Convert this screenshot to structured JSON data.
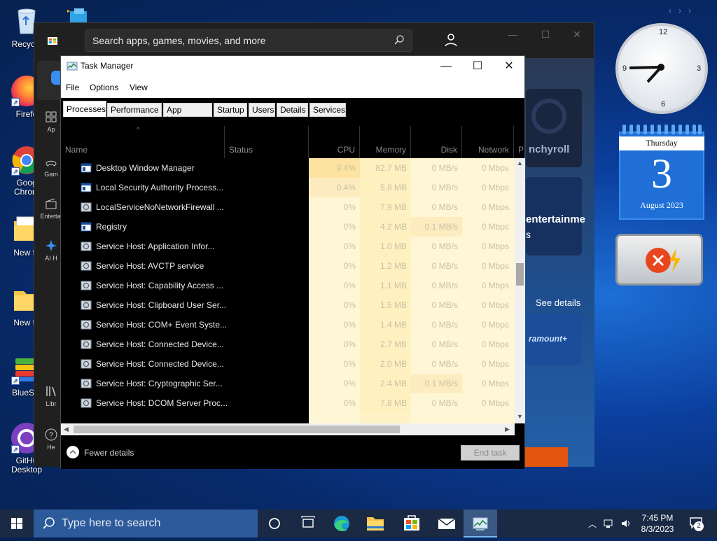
{
  "desktop": {
    "icons": [
      {
        "label": "Recycle",
        "name": "recycle-bin"
      },
      {
        "label": "Firefo",
        "name": "firefox"
      },
      {
        "label": "Goog\nChrom",
        "name": "google-chrome"
      },
      {
        "label": "New fo",
        "name": "new-folder-1"
      },
      {
        "label": "New fo",
        "name": "new-folder-2"
      },
      {
        "label": "BlueSta",
        "name": "bluestacks"
      },
      {
        "label": "GitHu\nDesktop",
        "name": "github-desktop"
      }
    ]
  },
  "store": {
    "search_placeholder": "Search apps, games, movies, and more",
    "nav": [
      {
        "label": "Ap"
      },
      {
        "label": "Gam"
      },
      {
        "label": "Entertai"
      },
      {
        "label": "AI H"
      },
      {
        "label": "Libr"
      },
      {
        "label": "He"
      }
    ],
    "tiles": {
      "crunchyroll": "nchyroll",
      "entertainment": "entertainme",
      "entertainment_sub": "s",
      "see_details": "See details",
      "paramount": "ramount+"
    }
  },
  "task_manager": {
    "title": "Task Manager",
    "menu": [
      "File",
      "Options",
      "View"
    ],
    "tabs": [
      "Processes",
      "Performance",
      "App history",
      "Startup",
      "Users",
      "Details",
      "Services"
    ],
    "active_tab": "Processes",
    "columns": {
      "name": "Name",
      "status": "Status",
      "cpu": "CPU",
      "memory": "Memory",
      "disk": "Disk",
      "network": "Network",
      "power": "P"
    },
    "rows": [
      {
        "name": "Desktop Window Manager",
        "cpu": "9.4%",
        "memory": "82.7 MB",
        "disk": "0 MB/s",
        "network": "0 Mbps",
        "icon": "window-icon"
      },
      {
        "name": "Local Security Authority Process...",
        "cpu": "0.4%",
        "memory": "5.8 MB",
        "disk": "0 MB/s",
        "network": "0 Mbps",
        "icon": "window-icon"
      },
      {
        "name": "LocalServiceNoNetworkFirewall ...",
        "cpu": "0%",
        "memory": "7.9 MB",
        "disk": "0 MB/s",
        "network": "0 Mbps",
        "icon": "gear-icon"
      },
      {
        "name": "Registry",
        "cpu": "0%",
        "memory": "4.2 MB",
        "disk": "0.1 MB/s",
        "network": "0 Mbps",
        "icon": "window-icon"
      },
      {
        "name": "Service Host: Application Infor...",
        "cpu": "0%",
        "memory": "1.0 MB",
        "disk": "0 MB/s",
        "network": "0 Mbps",
        "icon": "gear-icon"
      },
      {
        "name": "Service Host: AVCTP service",
        "cpu": "0%",
        "memory": "1.2 MB",
        "disk": "0 MB/s",
        "network": "0 Mbps",
        "icon": "gear-icon"
      },
      {
        "name": "Service Host: Capability Access ...",
        "cpu": "0%",
        "memory": "1.1 MB",
        "disk": "0 MB/s",
        "network": "0 Mbps",
        "icon": "gear-icon"
      },
      {
        "name": "Service Host: Clipboard User Ser...",
        "cpu": "0%",
        "memory": "1.5 MB",
        "disk": "0 MB/s",
        "network": "0 Mbps",
        "icon": "gear-icon"
      },
      {
        "name": "Service Host: COM+ Event Syste...",
        "cpu": "0%",
        "memory": "1.4 MB",
        "disk": "0 MB/s",
        "network": "0 Mbps",
        "icon": "gear-icon"
      },
      {
        "name": "Service Host: Connected Device...",
        "cpu": "0%",
        "memory": "2.7 MB",
        "disk": "0 MB/s",
        "network": "0 Mbps",
        "icon": "gear-icon"
      },
      {
        "name": "Service Host: Connected Device...",
        "cpu": "0%",
        "memory": "2.0 MB",
        "disk": "0 MB/s",
        "network": "0 Mbps",
        "icon": "gear-icon"
      },
      {
        "name": "Service Host: Cryptographic Ser...",
        "cpu": "0%",
        "memory": "2.4 MB",
        "disk": "0.1 MB/s",
        "network": "0 Mbps",
        "icon": "gear-icon"
      },
      {
        "name": "Service Host: DCOM Server Proc...",
        "cpu": "0%",
        "memory": "7.8 MB",
        "disk": "0 MB/s",
        "network": "0 Mbps",
        "icon": "gear-icon"
      }
    ],
    "fewer_details": "Fewer details",
    "end_task": "End task"
  },
  "gadgets": {
    "clock_numbers": [
      "12",
      "3",
      "6",
      "9"
    ],
    "calendar": {
      "weekday": "Thursday",
      "day": "3",
      "month_year": "August 2023"
    }
  },
  "taskbar": {
    "search_placeholder": "Type here to search",
    "time": "7:45 PM",
    "date": "8/3/2023",
    "notification_count": "2"
  },
  "colors": {
    "taskbar": "#1a2a44",
    "search_box": "#2d5a9a",
    "heat_high": "#fde9a8",
    "heat_low": "#fff6d5",
    "accent": "#1f6fd6"
  }
}
